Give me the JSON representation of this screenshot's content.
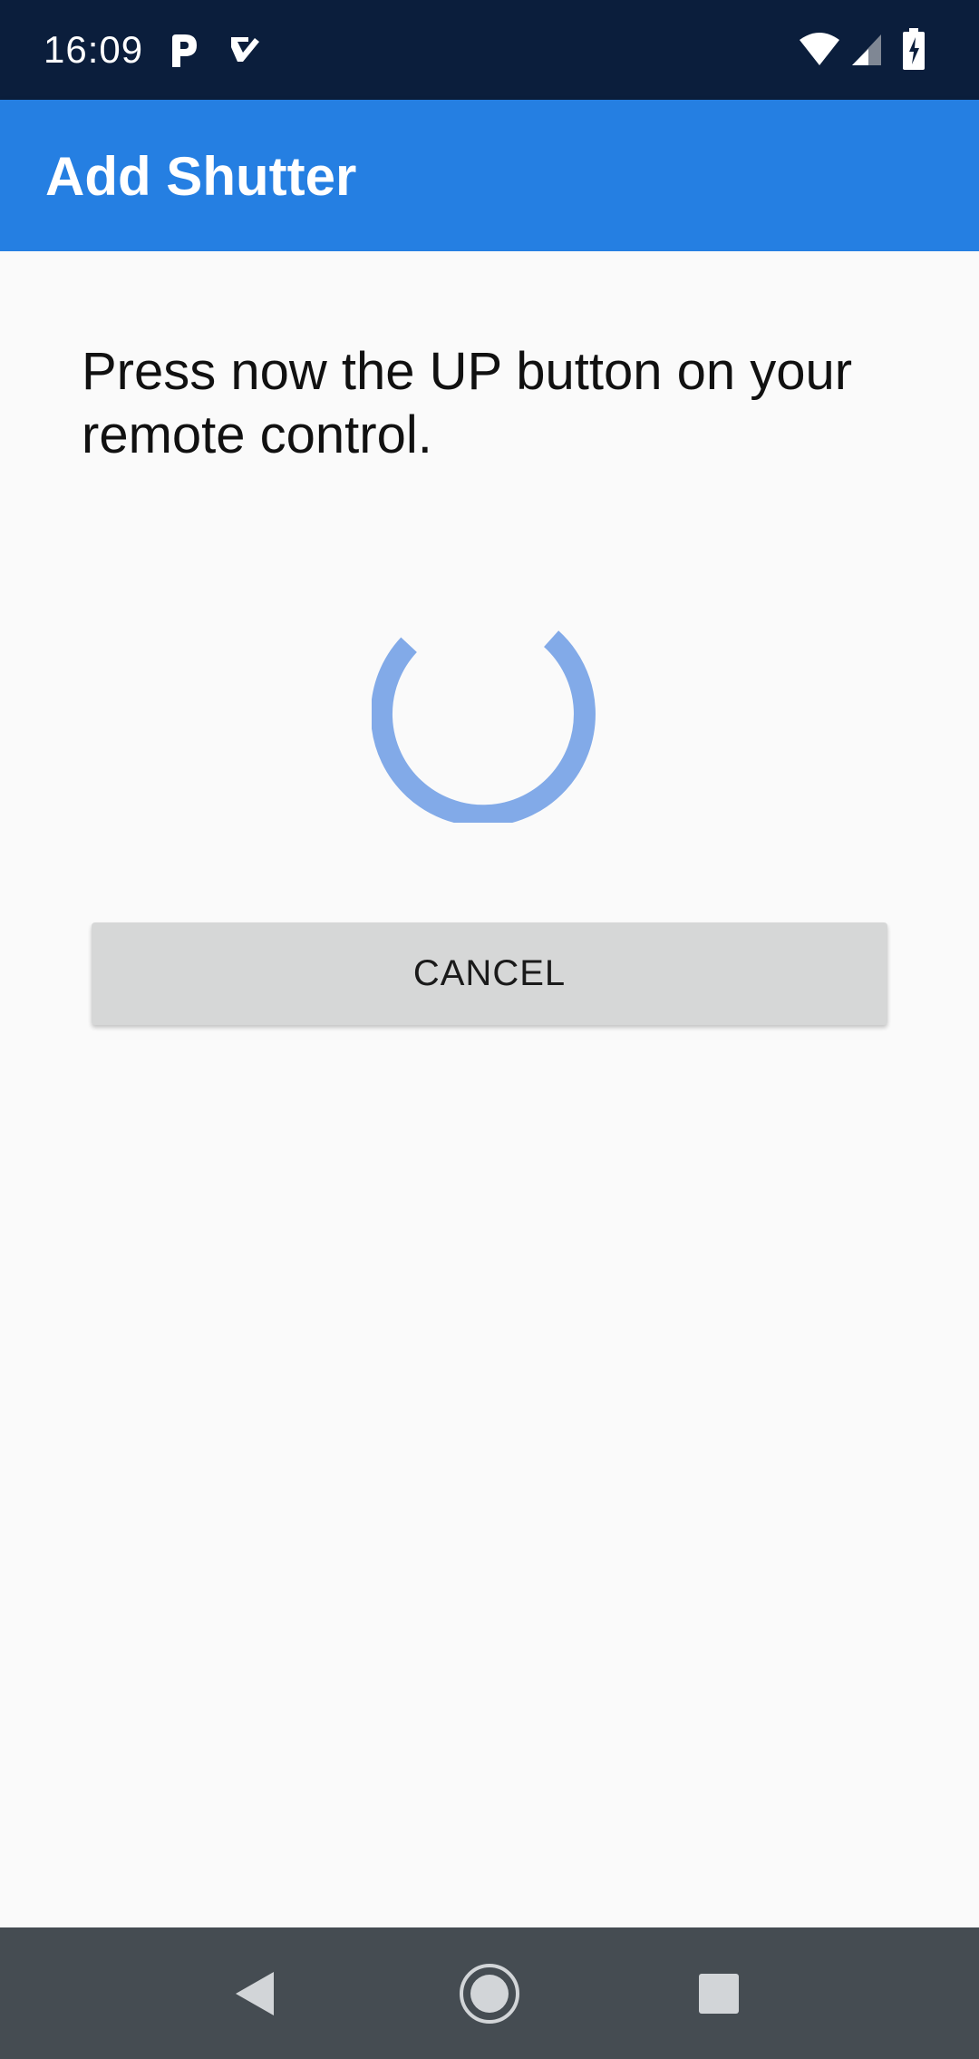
{
  "status_bar": {
    "time": "16:09",
    "icons": [
      "parking-app-icon",
      "task-check-app-icon",
      "wifi-icon",
      "cellular-signal-icon",
      "battery-charging-icon"
    ]
  },
  "app_bar": {
    "title": "Add Shutter",
    "color": "#257fe2"
  },
  "main": {
    "instruction": "Press now the UP button on your remote control.",
    "spinner": {
      "color": "#82aae8"
    },
    "cancel_label": "CANCEL"
  },
  "nav_bar": {
    "buttons": [
      "back-icon",
      "home-icon",
      "recents-icon"
    ]
  }
}
